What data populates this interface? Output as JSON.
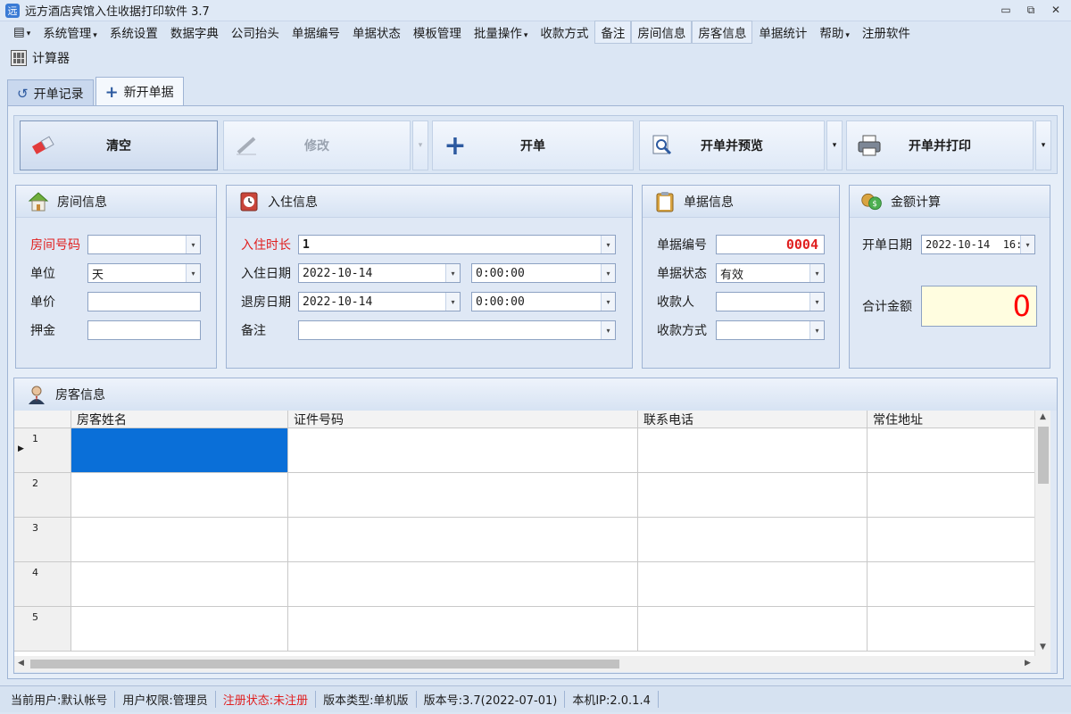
{
  "window": {
    "title": "远方酒店宾馆入住收据打印软件 3.7",
    "minimize": "▭",
    "restore": "⧉",
    "close": "✕"
  },
  "menu": [
    {
      "label": "系统管理",
      "dropdown": true,
      "boxed": false
    },
    {
      "label": "系统设置",
      "dropdown": false,
      "boxed": false
    },
    {
      "label": "数据字典",
      "dropdown": false,
      "boxed": false
    },
    {
      "label": "公司抬头",
      "dropdown": false,
      "boxed": false
    },
    {
      "label": "单据编号",
      "dropdown": false,
      "boxed": false
    },
    {
      "label": "单据状态",
      "dropdown": false,
      "boxed": false
    },
    {
      "label": "模板管理",
      "dropdown": false,
      "boxed": false
    },
    {
      "label": "批量操作",
      "dropdown": true,
      "boxed": false
    },
    {
      "label": "收款方式",
      "dropdown": false,
      "boxed": false
    },
    {
      "label": "备注",
      "dropdown": false,
      "boxed": true
    },
    {
      "label": "房间信息",
      "dropdown": false,
      "boxed": true
    },
    {
      "label": "房客信息",
      "dropdown": false,
      "boxed": true
    },
    {
      "label": "单据统计",
      "dropdown": false,
      "boxed": false
    },
    {
      "label": "帮助",
      "dropdown": true,
      "boxed": false
    },
    {
      "label": "注册软件",
      "dropdown": false,
      "boxed": false
    }
  ],
  "tools": {
    "calculator": "计算器"
  },
  "tabs": {
    "records": "开单记录",
    "new": "新开单据"
  },
  "actions": {
    "clear": "清空",
    "edit": "修改",
    "open": "开单",
    "open_preview": "开单并预览",
    "open_print": "开单并打印"
  },
  "room": {
    "title": "房间信息",
    "room_no_label": "房间号码",
    "room_no": "",
    "unit_label": "单位",
    "unit": "天",
    "price_label": "单价",
    "price": "",
    "deposit_label": "押金",
    "deposit": ""
  },
  "checkin": {
    "title": "入住信息",
    "duration_label": "入住时长",
    "duration": "1",
    "checkin_label": "入住日期",
    "checkin_date": "2022-10-14",
    "checkin_time": "0:00:00",
    "checkout_label": "退房日期",
    "checkout_date": "2022-10-14",
    "checkout_time": "0:00:00",
    "remark_label": "备注",
    "remark": ""
  },
  "receipt": {
    "title": "单据信息",
    "no_label": "单据编号",
    "no": "0004",
    "status_label": "单据状态",
    "status": "有效",
    "payee_label": "收款人",
    "payee": "",
    "method_label": "收款方式",
    "method": ""
  },
  "amount": {
    "title": "金额计算",
    "date_label": "开单日期",
    "date": "2022-10-14  16:",
    "total_label": "合计金额",
    "total": "0"
  },
  "guests": {
    "title": "房客信息",
    "columns": [
      "房客姓名",
      "证件号码",
      "联系电话",
      "常住地址"
    ],
    "rows": [
      "1",
      "2",
      "3",
      "4",
      "5"
    ]
  },
  "status": {
    "user": "当前用户:默认帐号",
    "role": "用户权限:管理员",
    "reg": "注册状态:未注册",
    "edition": "版本类型:单机版",
    "version": "版本号:3.7(2022-07-01)",
    "ip": "本机IP:2.0.1.4"
  },
  "colors": {
    "accent": "#0a6fd8",
    "warning": "#e02020",
    "total": "#ff0000"
  }
}
